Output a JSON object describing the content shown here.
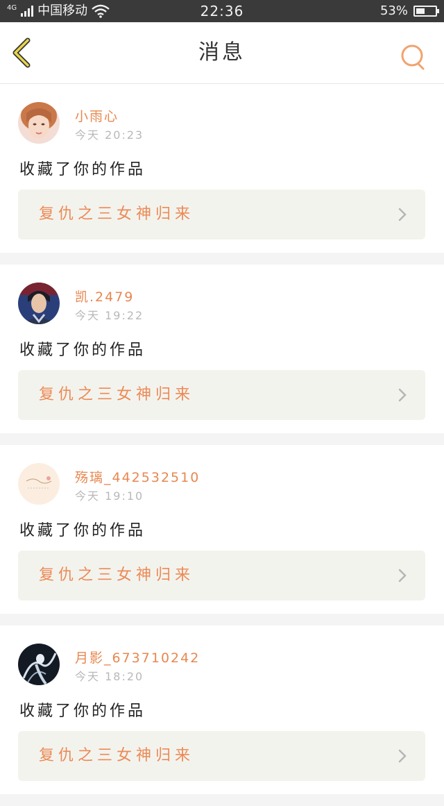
{
  "status_bar": {
    "network": "4G",
    "carrier": "中国移动",
    "time": "22:36",
    "battery": "53%"
  },
  "nav": {
    "title": "消息",
    "back_icon": "chevron-left-icon",
    "search_icon": "search-icon"
  },
  "colors": {
    "accent": "#e8874f",
    "back_arrow": "#e8d54a",
    "card_link_bg": "#f3f3ee"
  },
  "messages": [
    {
      "username": "小雨心",
      "time": "今天 20:23",
      "action": "收藏了你的作品",
      "work_title": "复仇之三女神归来"
    },
    {
      "username": "凯.2479",
      "time": "今天 19:22",
      "action": "收藏了你的作品",
      "work_title": "复仇之三女神归来"
    },
    {
      "username": "殇璃_442532510",
      "time": "今天 19:10",
      "action": "收藏了你的作品",
      "work_title": "复仇之三女神归来"
    },
    {
      "username": "月影_673710242",
      "time": "今天 18:20",
      "action": "收藏了你的作品",
      "work_title": "复仇之三女神归来"
    }
  ]
}
